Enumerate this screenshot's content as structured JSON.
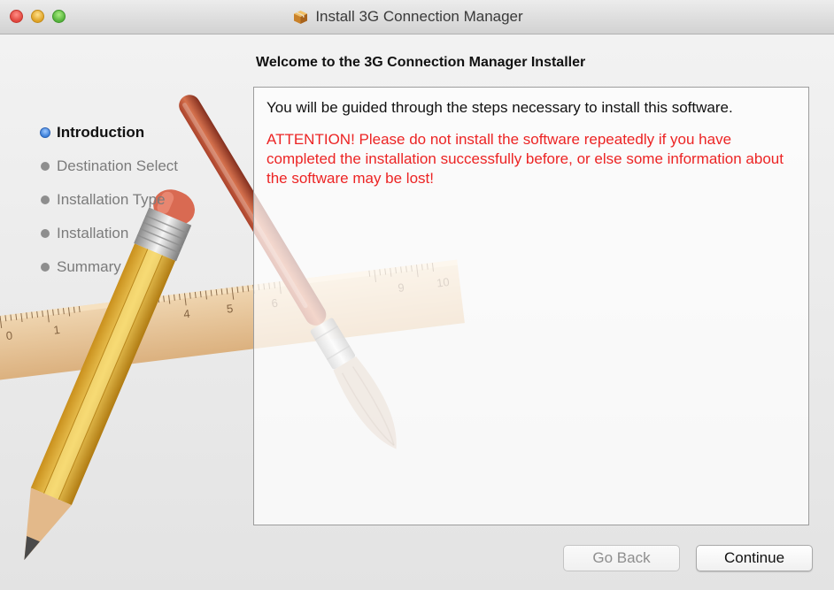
{
  "window": {
    "title": "Install 3G Connection Manager",
    "title_icon": "package-icon"
  },
  "heading": "Welcome to the 3G Connection Manager Installer",
  "steps": [
    {
      "label": "Introduction",
      "active": true
    },
    {
      "label": "Destination Select",
      "active": false
    },
    {
      "label": "Installation Type",
      "active": false
    },
    {
      "label": "Installation",
      "active": false
    },
    {
      "label": "Summary",
      "active": false
    }
  ],
  "body": {
    "intro": "You will be guided through the steps necessary to install this software.",
    "warning": "ATTENTION! Please do not install the software repeatedly if you have completed the installation successfully before, or else some information about the software may be lost!"
  },
  "buttons": {
    "back": "Go Back",
    "continue": "Continue"
  },
  "ruler_numbers": [
    "0",
    "1",
    "4",
    "5",
    "6",
    "9",
    "10"
  ],
  "colors": {
    "warning": "#ec2424",
    "active_step": "#3b7fd9"
  }
}
